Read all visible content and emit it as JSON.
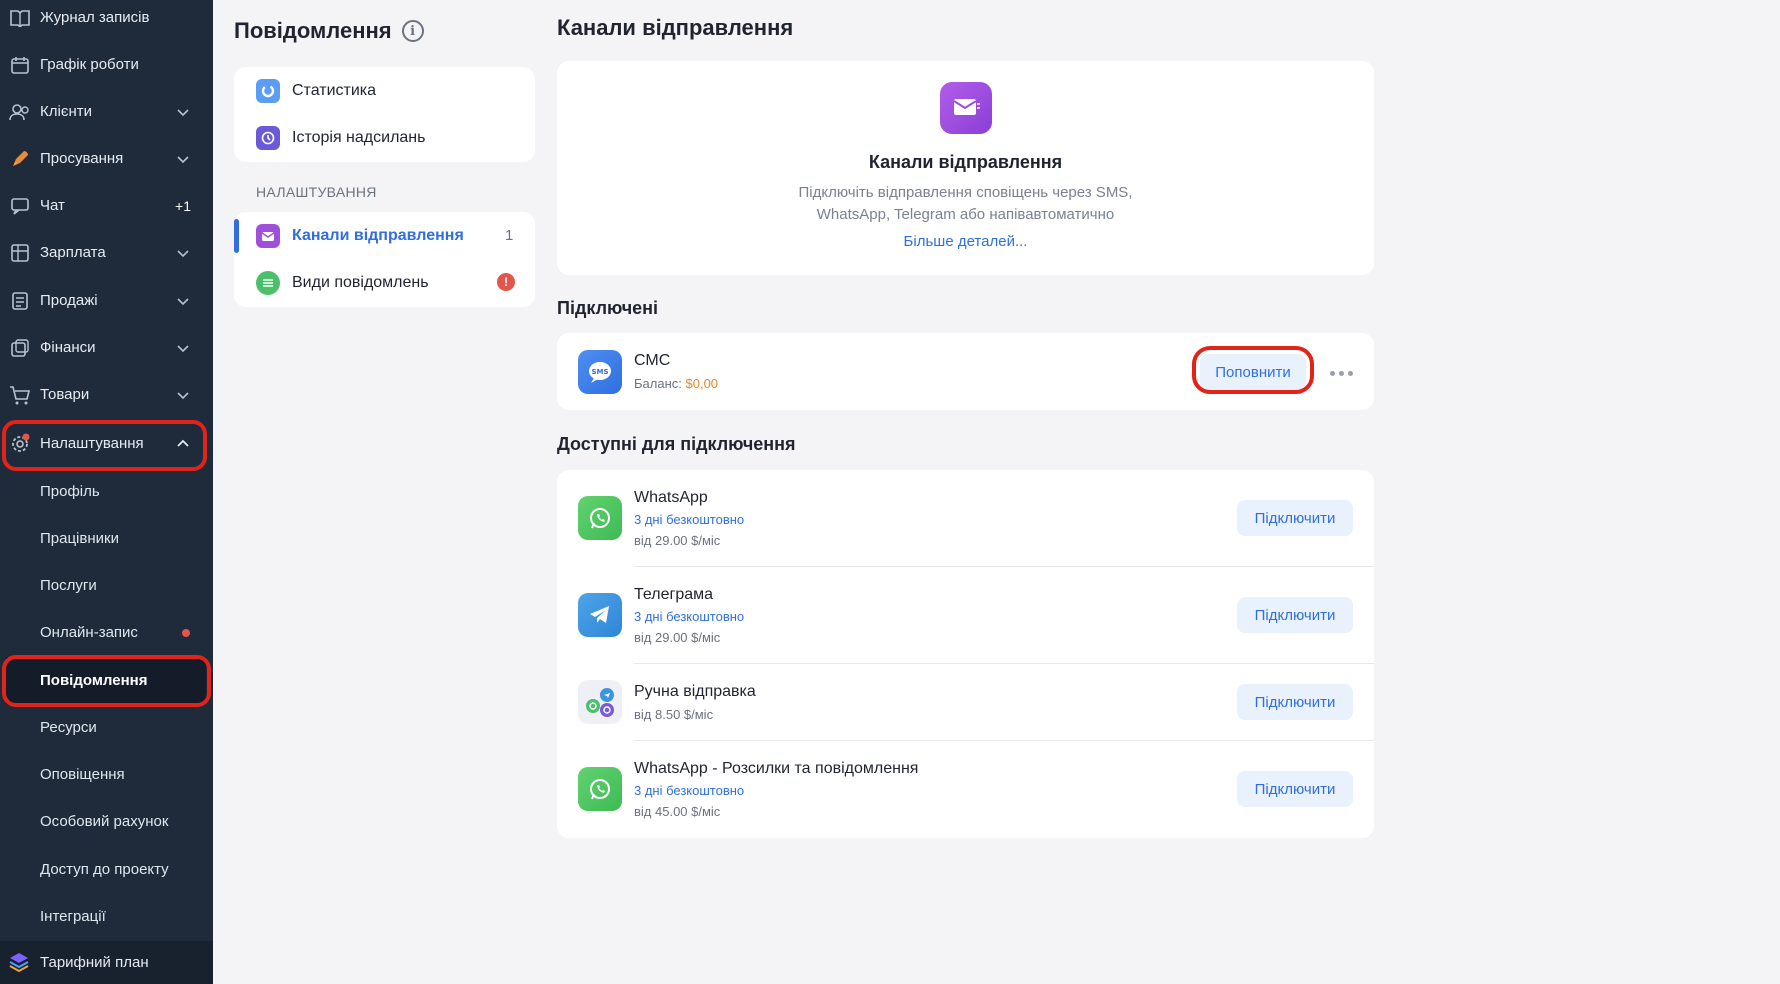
{
  "sidebar": {
    "items": [
      {
        "label": "Журнал записів",
        "icon": "journal-icon",
        "chevron": false
      },
      {
        "label": "Графік роботи",
        "icon": "calendar-icon",
        "chevron": false
      },
      {
        "label": "Клієнти",
        "icon": "clients-icon",
        "chevron": true
      },
      {
        "label": "Просування",
        "icon": "rocket-icon",
        "chevron": true
      },
      {
        "label": "Чат",
        "icon": "chat-icon",
        "badge": "+1"
      },
      {
        "label": "Зарплата",
        "icon": "salary-icon",
        "chevron": true
      },
      {
        "label": "Продажі",
        "icon": "sales-icon",
        "chevron": true
      },
      {
        "label": "Фінанси",
        "icon": "finance-icon",
        "chevron": true
      },
      {
        "label": "Товари",
        "icon": "goods-icon",
        "chevron": true
      },
      {
        "label": "Налаштування",
        "icon": "settings-icon",
        "chevron": true
      }
    ],
    "sub_items": [
      "Профіль",
      "Працівники",
      "Послуги",
      "Онлайн-запис",
      "Повідомлення",
      "Ресурси",
      "Оповіщення",
      "Особовий рахунок",
      "Доступ до проекту",
      "Інтеграції"
    ],
    "tariff": "Тарифний план"
  },
  "middle": {
    "title": "Повідомлення",
    "top_menu": [
      "Статистика",
      "Історія надсилань"
    ],
    "section_label": "НАЛАШТУВАННЯ",
    "settings_menu": [
      {
        "label": "Канали відправлення",
        "count": "1"
      },
      {
        "label": "Види повідомлень",
        "alert": "!"
      }
    ]
  },
  "main": {
    "title": "Канали відправлення",
    "hero": {
      "title": "Канали відправлення",
      "desc_line1": "Підключіть відправлення сповіщень через SMS,",
      "desc_line2": "WhatsApp, Telegram або напівавтоматично",
      "link": "Більше деталей..."
    },
    "connected_title": "Підключені",
    "connected": {
      "name": "СМС",
      "balance_label": "Баланс:",
      "balance_value": "$0,00",
      "button": "Поповнити"
    },
    "available_title": "Доступні для підключення",
    "available": [
      {
        "name": "WhatsApp",
        "trial": "3 дні безкоштовно",
        "price": "від 29.00 $/міс",
        "button": "Підключити"
      },
      {
        "name": "Телеграма",
        "trial": "3 дні безкоштовно",
        "price": "від 29.00 $/міс",
        "button": "Підключити"
      },
      {
        "name": "Ручна відправка",
        "trial": "",
        "price": "від 8.50 $/міс",
        "button": "Підключити"
      },
      {
        "name": "WhatsApp - Розсилки та повідомлення",
        "trial": "3 дні безкоштовно",
        "price": "від 45.00 $/міс",
        "button": "Підключити"
      }
    ]
  },
  "colors": {
    "accent": "#2f6fe0",
    "sidebar_bg": "#1f2b3b",
    "highlight": "#e2231a",
    "balance": "#e7852b"
  }
}
